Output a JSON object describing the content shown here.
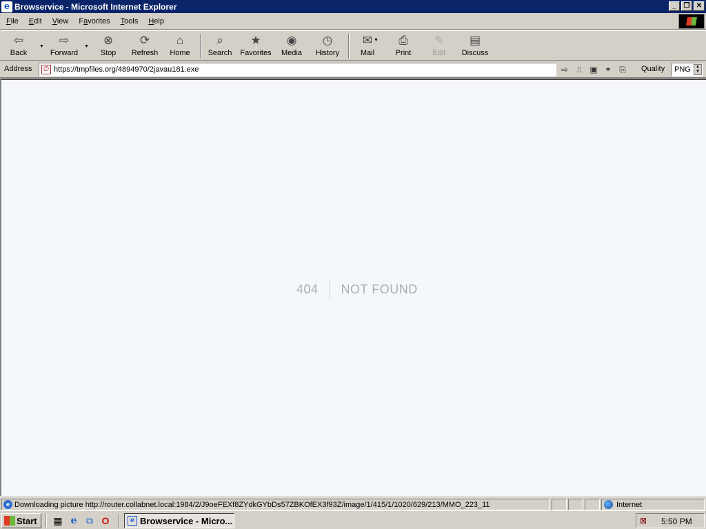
{
  "window": {
    "title": "Browservice - Microsoft Internet Explorer",
    "app_icon": "e",
    "minimize": "_",
    "maximize": "❐",
    "close": "✕"
  },
  "menu": [
    {
      "label": "File",
      "key": "F"
    },
    {
      "label": "Edit",
      "key": "E"
    },
    {
      "label": "View",
      "key": "V"
    },
    {
      "label": "Favorites",
      "key": "a"
    },
    {
      "label": "Tools",
      "key": "T"
    },
    {
      "label": "Help",
      "key": "H"
    }
  ],
  "toolbar": {
    "back": "Back",
    "forward": "Forward",
    "stop": "Stop",
    "refresh": "Refresh",
    "home": "Home",
    "search": "Search",
    "favorites": "Favorites",
    "media": "Media",
    "history": "History",
    "mail": "Mail",
    "print": "Print",
    "edit": "Edit",
    "discuss": "Discuss"
  },
  "address": {
    "label": "Address",
    "url": "https://tmpfiles.org/4894970/2javau181.exe",
    "quality_label": "Quality",
    "quality_value": "PNG"
  },
  "page": {
    "error_code": "404",
    "error_message": "NOT FOUND"
  },
  "status": {
    "text": "Downloading picture http://router.collabnet.local:1984/2/J9oeFEXf8ZYdkGYbDs57ZBKOfEX3f93Z/image/1/415/1/1020/629/213/MMO_223_11",
    "zone": "Internet"
  },
  "taskbar": {
    "start": "Start",
    "task_title": "Browservice - Micro...",
    "clock": "5:50 PM"
  }
}
